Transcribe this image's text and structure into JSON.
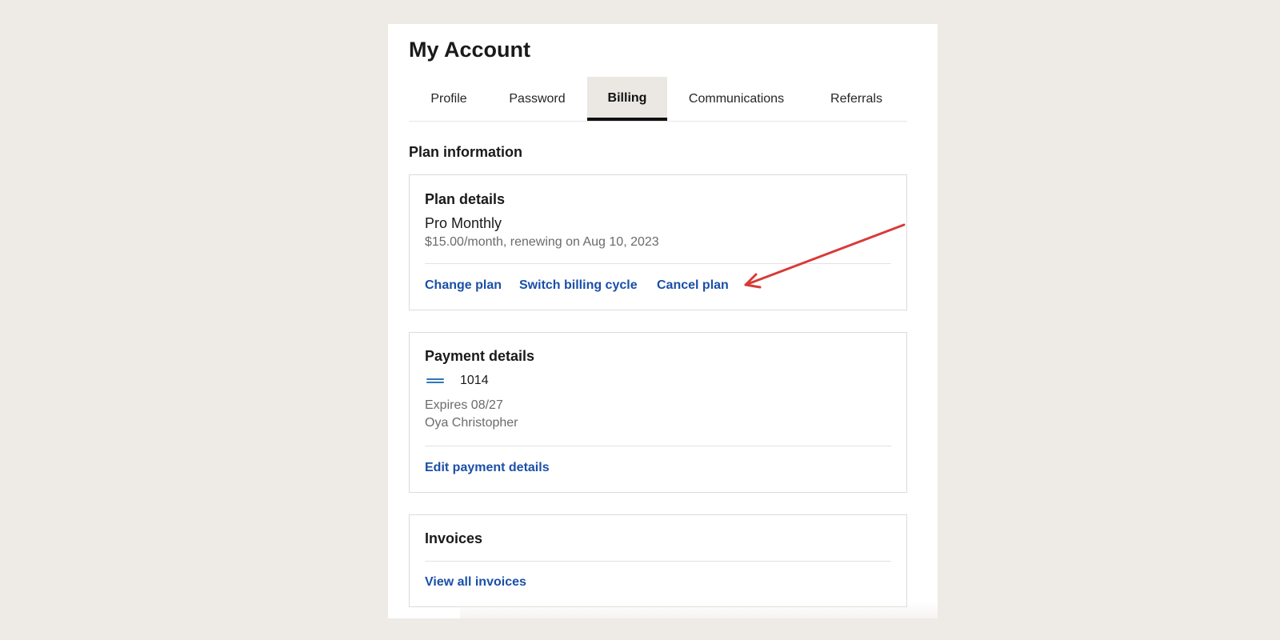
{
  "page": {
    "title": "My Account"
  },
  "tabs": [
    {
      "label": "Profile",
      "active": false
    },
    {
      "label": "Password",
      "active": false
    },
    {
      "label": "Billing",
      "active": true
    },
    {
      "label": "Communications",
      "active": false
    },
    {
      "label": "Referrals",
      "active": false
    }
  ],
  "plan_information": {
    "heading": "Plan information",
    "card_title": "Plan details",
    "plan_name": "Pro Monthly",
    "price_text": "$15.00/month, renewing on Aug 10, 2023",
    "actions": {
      "change_plan": "Change plan",
      "switch_billing_cycle": "Switch billing cycle",
      "cancel_plan": "Cancel plan"
    }
  },
  "payment_details": {
    "card_title": "Payment details",
    "card_brand_icon": "american-express-icon",
    "card_last4": "1014",
    "expires": "Expires 08/27",
    "cardholder": "Oya Christopher",
    "edit_label": "Edit payment details"
  },
  "invoices": {
    "card_title": "Invoices",
    "view_all_label": "View all invoices"
  },
  "annotation": {
    "arrow_icon": "red-arrow-annotation",
    "color": "#d93a36"
  },
  "colors": {
    "background": "#eeebe6",
    "link": "#1b4fa8",
    "active_tab_bg": "#ebe8e3"
  }
}
